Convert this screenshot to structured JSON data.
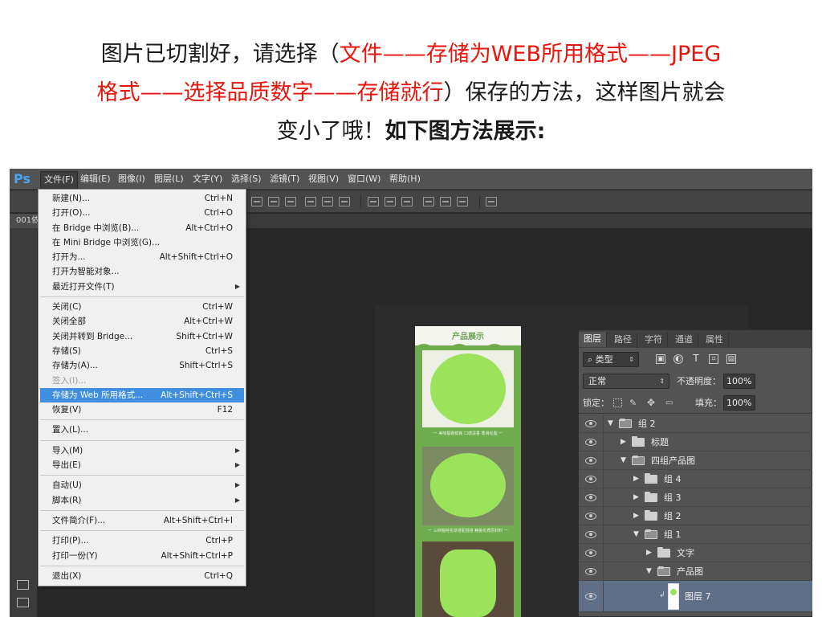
{
  "instruction": {
    "line1_a": "图片已切割好，请选择（",
    "line1_red": "文件——存储为WEB所用格式——JPEG",
    "line2_red": "格式——选择品质数字——存储就行",
    "line2_b": "）保存的方法，这样图片就会",
    "line3_a": "变小了哦！",
    "line3_bold": "如下图方法展示:"
  },
  "app": {
    "logo": "Ps",
    "menus": [
      "文件(F)",
      "编辑(E)",
      "图像(I)",
      "图层(L)",
      "文字(Y)",
      "选择(S)",
      "滤镜(T)",
      "视图(V)",
      "窗口(W)",
      "帮助(H)"
    ],
    "active_menu": "文件(F)",
    "doc_tab": "001依"
  },
  "file_menu": [
    {
      "label": "新建(N)...",
      "shortcut": "Ctrl+N"
    },
    {
      "label": "打开(O)...",
      "shortcut": "Ctrl+O"
    },
    {
      "label": "在 Bridge 中浏览(B)...",
      "shortcut": "Alt+Ctrl+O"
    },
    {
      "label": "在 Mini Bridge 中浏览(G)...",
      "shortcut": ""
    },
    {
      "label": "打开为...",
      "shortcut": "Alt+Shift+Ctrl+O"
    },
    {
      "label": "打开为智能对象...",
      "shortcut": ""
    },
    {
      "label": "最近打开文件(T)",
      "shortcut": "",
      "submenu": true
    },
    {
      "sep": true
    },
    {
      "label": "关闭(C)",
      "shortcut": "Ctrl+W"
    },
    {
      "label": "关闭全部",
      "shortcut": "Alt+Ctrl+W"
    },
    {
      "label": "关闭并转到 Bridge...",
      "shortcut": "Shift+Ctrl+W"
    },
    {
      "label": "存储(S)",
      "shortcut": "Ctrl+S"
    },
    {
      "label": "存储为(A)...",
      "shortcut": "Shift+Ctrl+S"
    },
    {
      "label": "签入(I)...",
      "shortcut": "",
      "disabled": true
    },
    {
      "label": "存储为 Web 所用格式...",
      "shortcut": "Alt+Shift+Ctrl+S",
      "highlight": true
    },
    {
      "label": "恢复(V)",
      "shortcut": "F12"
    },
    {
      "sep": true
    },
    {
      "label": "置入(L)...",
      "shortcut": ""
    },
    {
      "sep": true
    },
    {
      "label": "导入(M)",
      "shortcut": "",
      "submenu": true
    },
    {
      "label": "导出(E)",
      "shortcut": "",
      "submenu": true
    },
    {
      "sep": true
    },
    {
      "label": "自动(U)",
      "shortcut": "",
      "submenu": true
    },
    {
      "label": "脚本(R)",
      "shortcut": "",
      "submenu": true
    },
    {
      "sep": true
    },
    {
      "label": "文件简介(F)...",
      "shortcut": "Alt+Shift+Ctrl+I"
    },
    {
      "sep": true
    },
    {
      "label": "打印(P)...",
      "shortcut": "Ctrl+P"
    },
    {
      "label": "打印一份(Y)",
      "shortcut": "Alt+Shift+Ctrl+P"
    },
    {
      "sep": true
    },
    {
      "label": "退出(X)",
      "shortcut": "Ctrl+Q"
    }
  ],
  "artwork": {
    "title": "产品展示",
    "caption1": "一 美味极致鲜爽 口感清香 香滑松脂 一",
    "caption2": "一 三种独特花草搭配混搭 精挑优质原材料 一"
  },
  "layers_panel": {
    "tabs": [
      "图层",
      "路径",
      "字符",
      "通道",
      "属性"
    ],
    "active_tab": "图层",
    "filter_kind": "类型",
    "blend_mode": "正常",
    "opacity_label": "不透明度：",
    "opacity_value": "100%",
    "lock_label": "锁定：",
    "fill_label": "填充：",
    "fill_value": "100%",
    "layers": [
      {
        "name": "组 2",
        "indent": 0,
        "open": true
      },
      {
        "name": "标题",
        "indent": 1,
        "open": false
      },
      {
        "name": "四组产品图",
        "indent": 1,
        "open": true
      },
      {
        "name": "组 4",
        "indent": 2,
        "open": false
      },
      {
        "name": "组 3",
        "indent": 2,
        "open": false
      },
      {
        "name": "组 2",
        "indent": 2,
        "open": false
      },
      {
        "name": "组 1",
        "indent": 2,
        "open": true
      },
      {
        "name": "文字",
        "indent": 3,
        "open": false
      },
      {
        "name": "产品图",
        "indent": 3,
        "open": true
      },
      {
        "name": "图层 7",
        "indent": 4,
        "selected": true
      }
    ]
  },
  "colors": {
    "accent_red": "#e8150d",
    "menu_highlight": "#3f8ee0",
    "ps_blue": "#49a4f5",
    "artwork_green": "#6fab4f"
  }
}
